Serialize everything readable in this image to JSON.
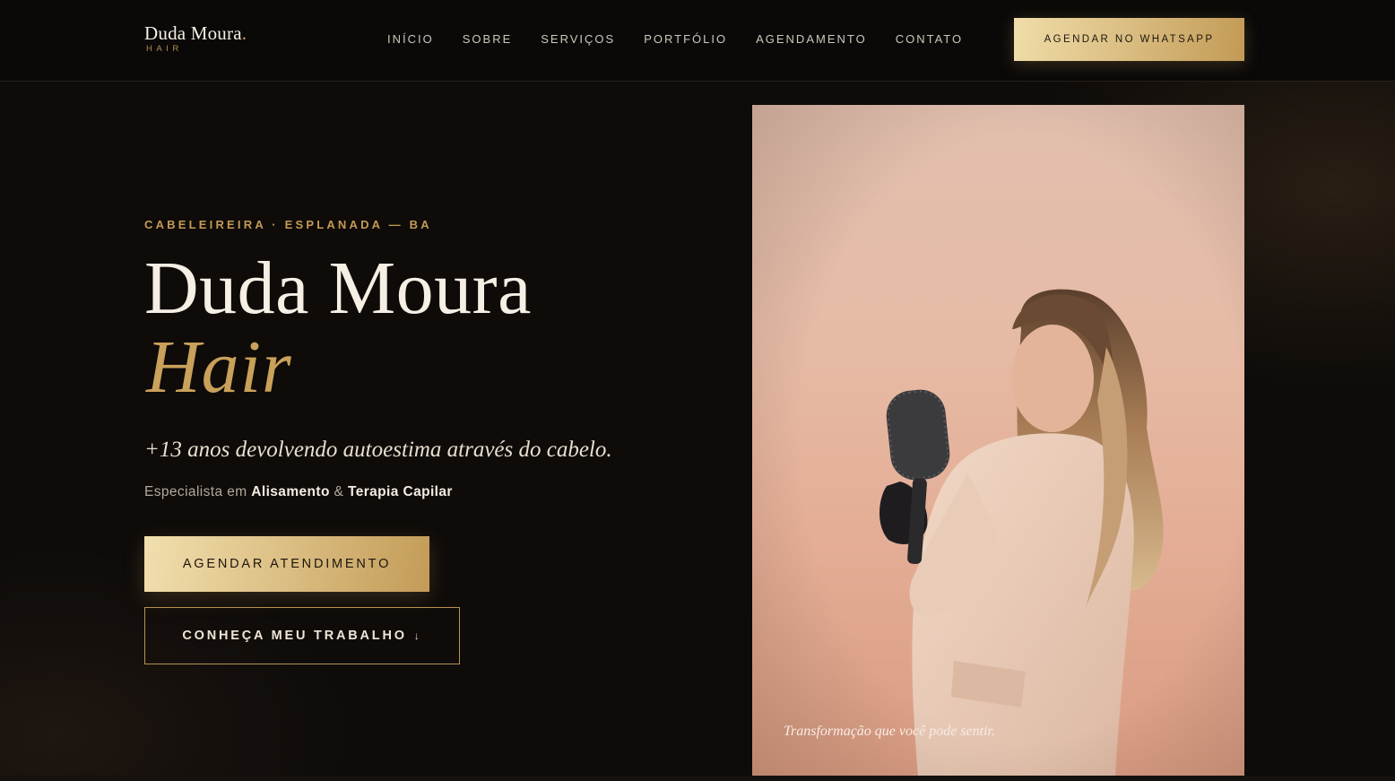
{
  "brand": {
    "name": "Duda Moura",
    "dot": ".",
    "sub": "HAIR"
  },
  "nav": {
    "items": [
      {
        "label": "INÍCIO"
      },
      {
        "label": "SOBRE"
      },
      {
        "label": "SERVIÇOS"
      },
      {
        "label": "PORTFÓLIO"
      },
      {
        "label": "AGENDAMENTO"
      },
      {
        "label": "CONTATO"
      }
    ],
    "cta_label": "AGENDAR NO WHATSAPP"
  },
  "hero": {
    "eyebrow": "CABELEIREIRA · ESPLANADA — BA",
    "title_line1": "Duda Moura",
    "title_line2": "Hair",
    "tagline": "+13 anos devolvendo autoestima através do cabelo.",
    "specialist_prefix": "Especialista em ",
    "specialist_strong1": "Alisamento",
    "specialist_amp": " & ",
    "specialist_strong2": "Terapia Capilar",
    "primary_cta": "AGENDAR ATENDIMENTO",
    "secondary_cta": "CONHEÇA MEU TRABALHO",
    "secondary_cta_icon": "↓",
    "photo_caption": "Transformação que você pode sentir."
  },
  "colors": {
    "background": "#0e0b09",
    "gold": "#c9a15a",
    "gold_light": "#f0dda9",
    "text": "#f6efe4",
    "muted": "#b4aa9c",
    "photo_bg": "#e2bfae"
  },
  "icons": {
    "scroll_down": "arrow-down-icon"
  }
}
